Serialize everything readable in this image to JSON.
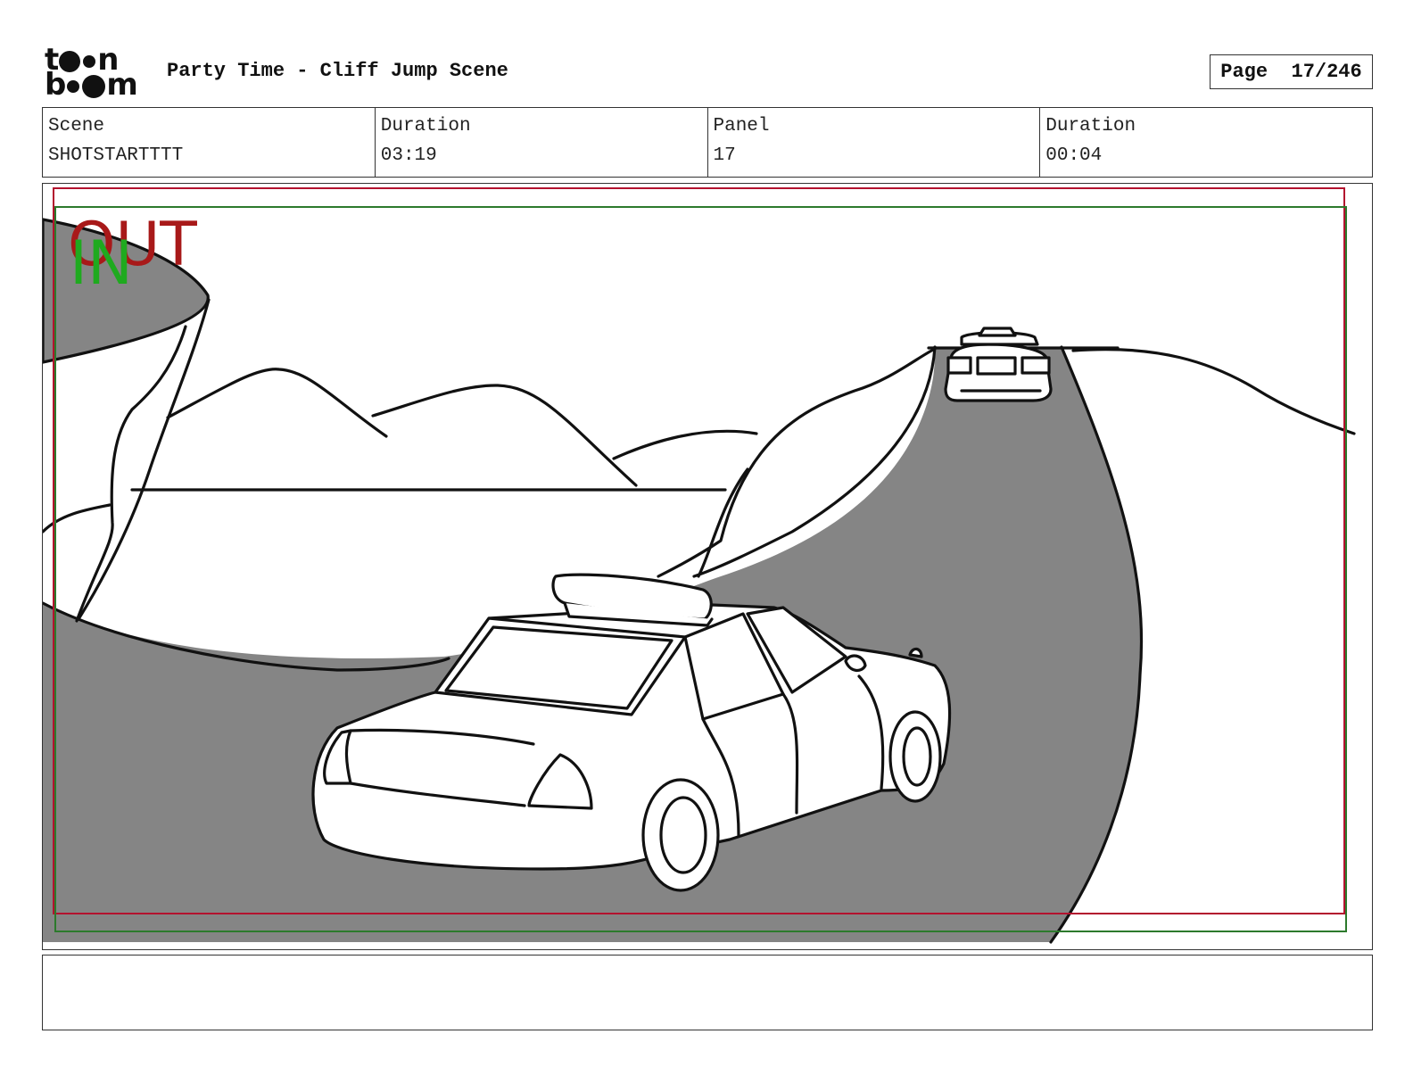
{
  "header": {
    "logo_row1": {
      "a": "t",
      "b": "n"
    },
    "logo_row2": {
      "a": "b",
      "b": "m"
    },
    "title": "Party Time - Cliff Jump Scene",
    "page_label": "Page",
    "page_number": "17/246"
  },
  "info": {
    "scene_label": "Scene",
    "scene_value": "SHOTSTARTTTT",
    "scene_duration_label": "Duration",
    "scene_duration_value": "03:19",
    "panel_label": "Panel",
    "panel_value": "17",
    "panel_duration_label": "Duration",
    "panel_duration_value": "00:04"
  },
  "panel": {
    "out_label": "OUT",
    "in_label": "IN",
    "colors": {
      "out_frame": "#b3122e",
      "in_frame": "#2c7a2c",
      "road": "#858585",
      "ink": "#111111"
    }
  },
  "notes": {
    "text": ""
  }
}
